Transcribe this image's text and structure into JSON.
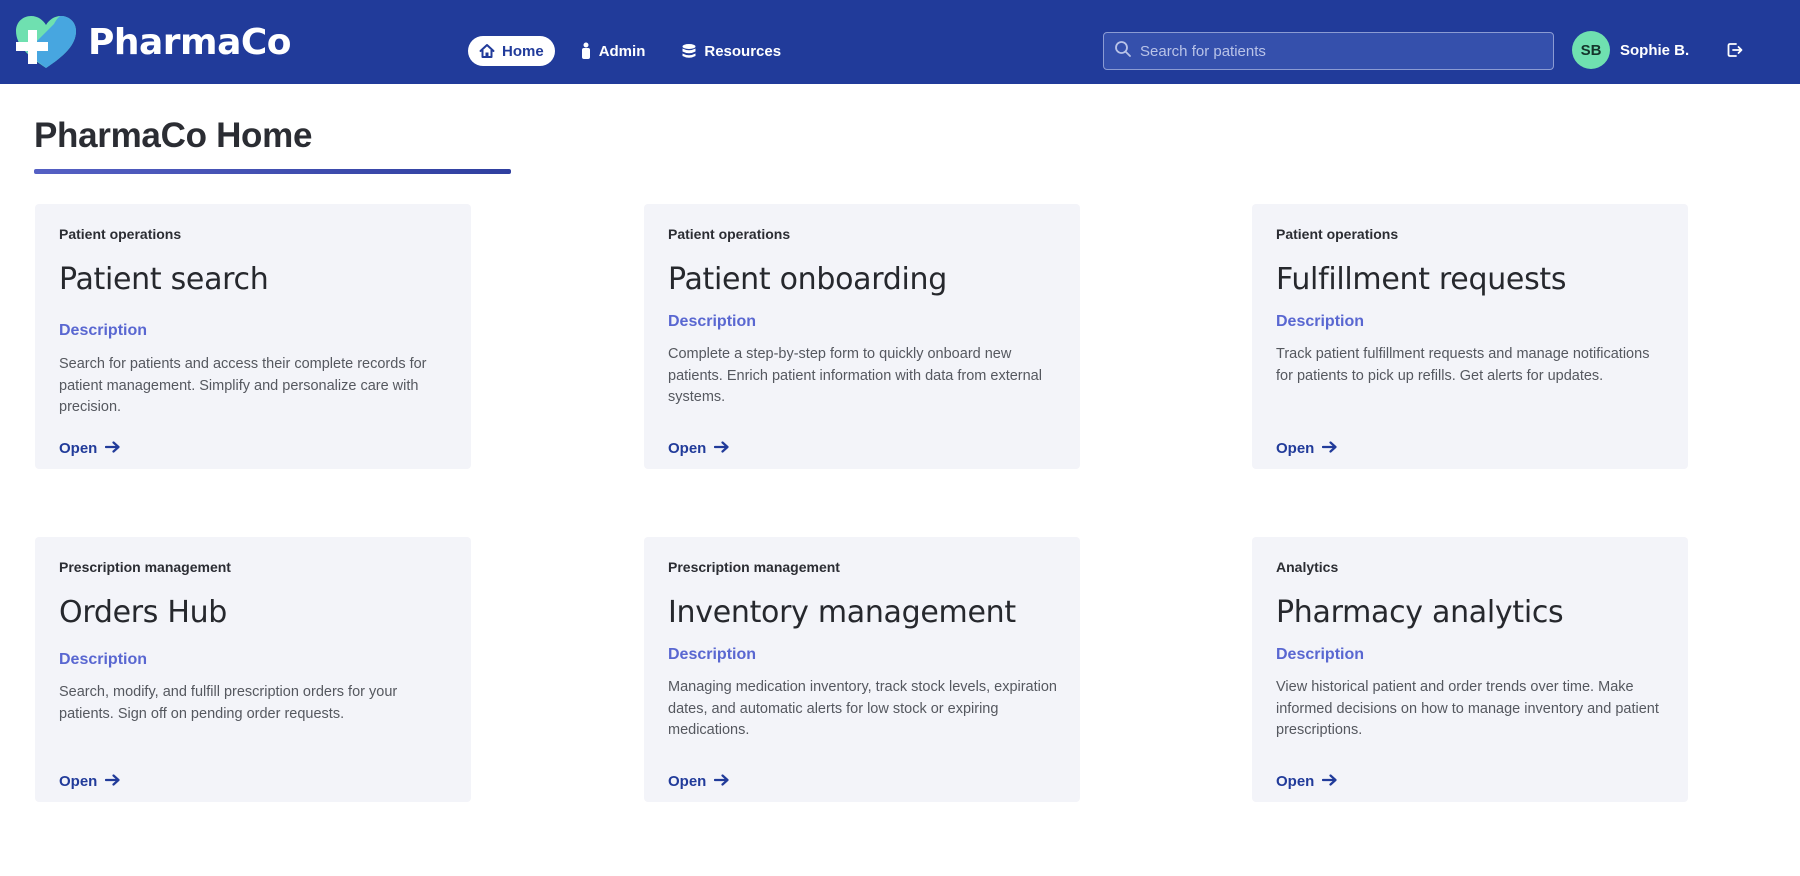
{
  "app": {
    "name": "PharmaCo"
  },
  "nav": {
    "items": [
      {
        "label": "Home",
        "icon": "home-icon",
        "active": true
      },
      {
        "label": "Admin",
        "icon": "person-icon",
        "active": false
      },
      {
        "label": "Resources",
        "icon": "database-icon",
        "active": false
      }
    ]
  },
  "search": {
    "placeholder": "Search for patients",
    "value": ""
  },
  "user": {
    "initials": "SB",
    "name": "Sophie B."
  },
  "page": {
    "title": "PharmaCo Home"
  },
  "cards": [
    {
      "category": "Patient operations",
      "title": "Patient search",
      "description_label": "Description",
      "description": "Search for patients and access their complete records for patient management. Simplify and personalize care with precision.",
      "open_label": "Open"
    },
    {
      "category": "Patient operations",
      "title": "Patient onboarding",
      "description_label": "Description",
      "description": "Complete a step-by-step form to quickly onboard new patients. Enrich patient information with data from external systems.",
      "open_label": "Open"
    },
    {
      "category": "Patient operations",
      "title": "Fulfillment requests",
      "description_label": "Description",
      "description": "Track patient fulfillment requests and manage notifications for patients to pick up refills. Get alerts for updates.",
      "open_label": "Open"
    },
    {
      "category": "Prescription management",
      "title": "Orders Hub",
      "description_label": "Description",
      "description": "Search, modify, and fulfill prescription orders for your patients. Sign off on pending order requests.",
      "open_label": "Open"
    },
    {
      "category": "Prescription management",
      "title": "Inventory management",
      "description_label": "Description",
      "description": "Managing medication inventory, track stock levels, expiration dates, and automatic alerts for low stock or expiring medications.",
      "open_label": "Open"
    },
    {
      "category": "Analytics",
      "title": "Pharmacy analytics",
      "description_label": "Description",
      "description": "View historical patient and order trends over time. Make informed decisions on how to manage inventory and patient prescriptions.",
      "open_label": "Open"
    }
  ],
  "colors": {
    "header": "#213b9a",
    "accent": "#5967d1",
    "card_bg": "#f3f4f9",
    "avatar": "#6fe0b0"
  }
}
